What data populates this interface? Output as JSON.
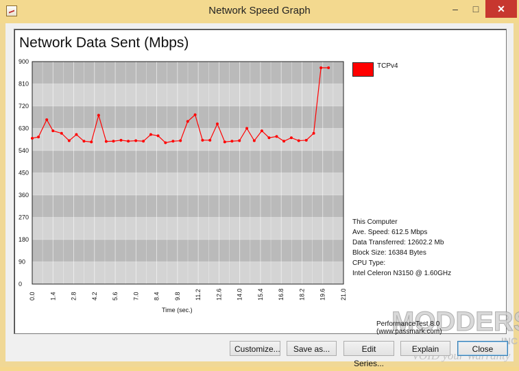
{
  "window": {
    "title": "Network Speed Graph",
    "controls": {
      "minimize": "–",
      "maximize": "□",
      "close": "✕"
    }
  },
  "graph": {
    "title": "Network Data Sent (Mbps)",
    "legend": [
      {
        "name": "TCPv4",
        "color": "#ff0000"
      }
    ],
    "stats": {
      "computer": "This Computer",
      "ave_speed": "Ave. Speed: 612.5 Mbps",
      "data_transferred": "Data Transferred: 12602.2 Mb",
      "block_size": "Block Size: 16384 Bytes",
      "cpu_type_label": "CPU Type:",
      "cpu_type_value": "Intel Celeron N3150 @ 1.60GHz"
    },
    "credit": "PerformanceTest 8.0 (www.passmark.com)"
  },
  "chart_data": {
    "type": "line",
    "title": "Network Data Sent (Mbps)",
    "xlabel": "Time (sec.)",
    "ylabel": "",
    "xlim": [
      0,
      21.0
    ],
    "ylim": [
      0,
      900
    ],
    "y_ticks": [
      "0",
      "90",
      "180",
      "270",
      "360",
      "450",
      "540",
      "630",
      "720",
      "810",
      "900"
    ],
    "x_ticks": [
      "0.0",
      "1.4",
      "2.8",
      "4.2",
      "5.6",
      "7.0",
      "8.4",
      "9.8",
      "11.2",
      "12.6",
      "14.0",
      "15.4",
      "16.8",
      "18.2",
      "19.6",
      "21.0"
    ],
    "grid": true,
    "legend_position": "top-right",
    "series": [
      {
        "name": "TCPv4",
        "color": "#ff0000",
        "x": [
          0.0,
          0.42,
          0.98,
          1.4,
          1.98,
          2.49,
          2.98,
          3.49,
          3.99,
          4.48,
          4.99,
          5.48,
          5.99,
          6.48,
          6.99,
          7.5,
          8.0,
          8.49,
          8.99,
          9.5,
          10.0,
          10.49,
          10.99,
          11.49,
          11.99,
          12.49,
          12.99,
          13.48,
          13.98,
          14.48,
          14.98,
          15.49,
          15.98,
          16.49,
          16.98,
          17.48,
          17.98,
          18.49,
          18.99,
          19.48,
          19.99
        ],
        "y": [
          590,
          595,
          665,
          620,
          610,
          580,
          605,
          578,
          575,
          683,
          577,
          578,
          582,
          578,
          580,
          578,
          605,
          600,
          572,
          578,
          580,
          658,
          685,
          582,
          582,
          648,
          575,
          578,
          580,
          630,
          580,
          620,
          592,
          597,
          578,
          592,
          580,
          582,
          610,
          875,
          875
        ]
      }
    ]
  },
  "buttons": {
    "customize": "Customize...",
    "save_as": "Save as...",
    "edit_series": "Edit Series...",
    "explain": "Explain",
    "close": "Close"
  },
  "watermark": {
    "brand": "MODDERS",
    "sub": "INC",
    "tagline": "VOID your Warranty"
  },
  "colors": {
    "title_bar": "#f3d98f",
    "close_button": "#c7372f",
    "series": "#ff0000",
    "plot_band_dark": "#b9b9b9",
    "plot_band_light": "#d4d4d4"
  }
}
